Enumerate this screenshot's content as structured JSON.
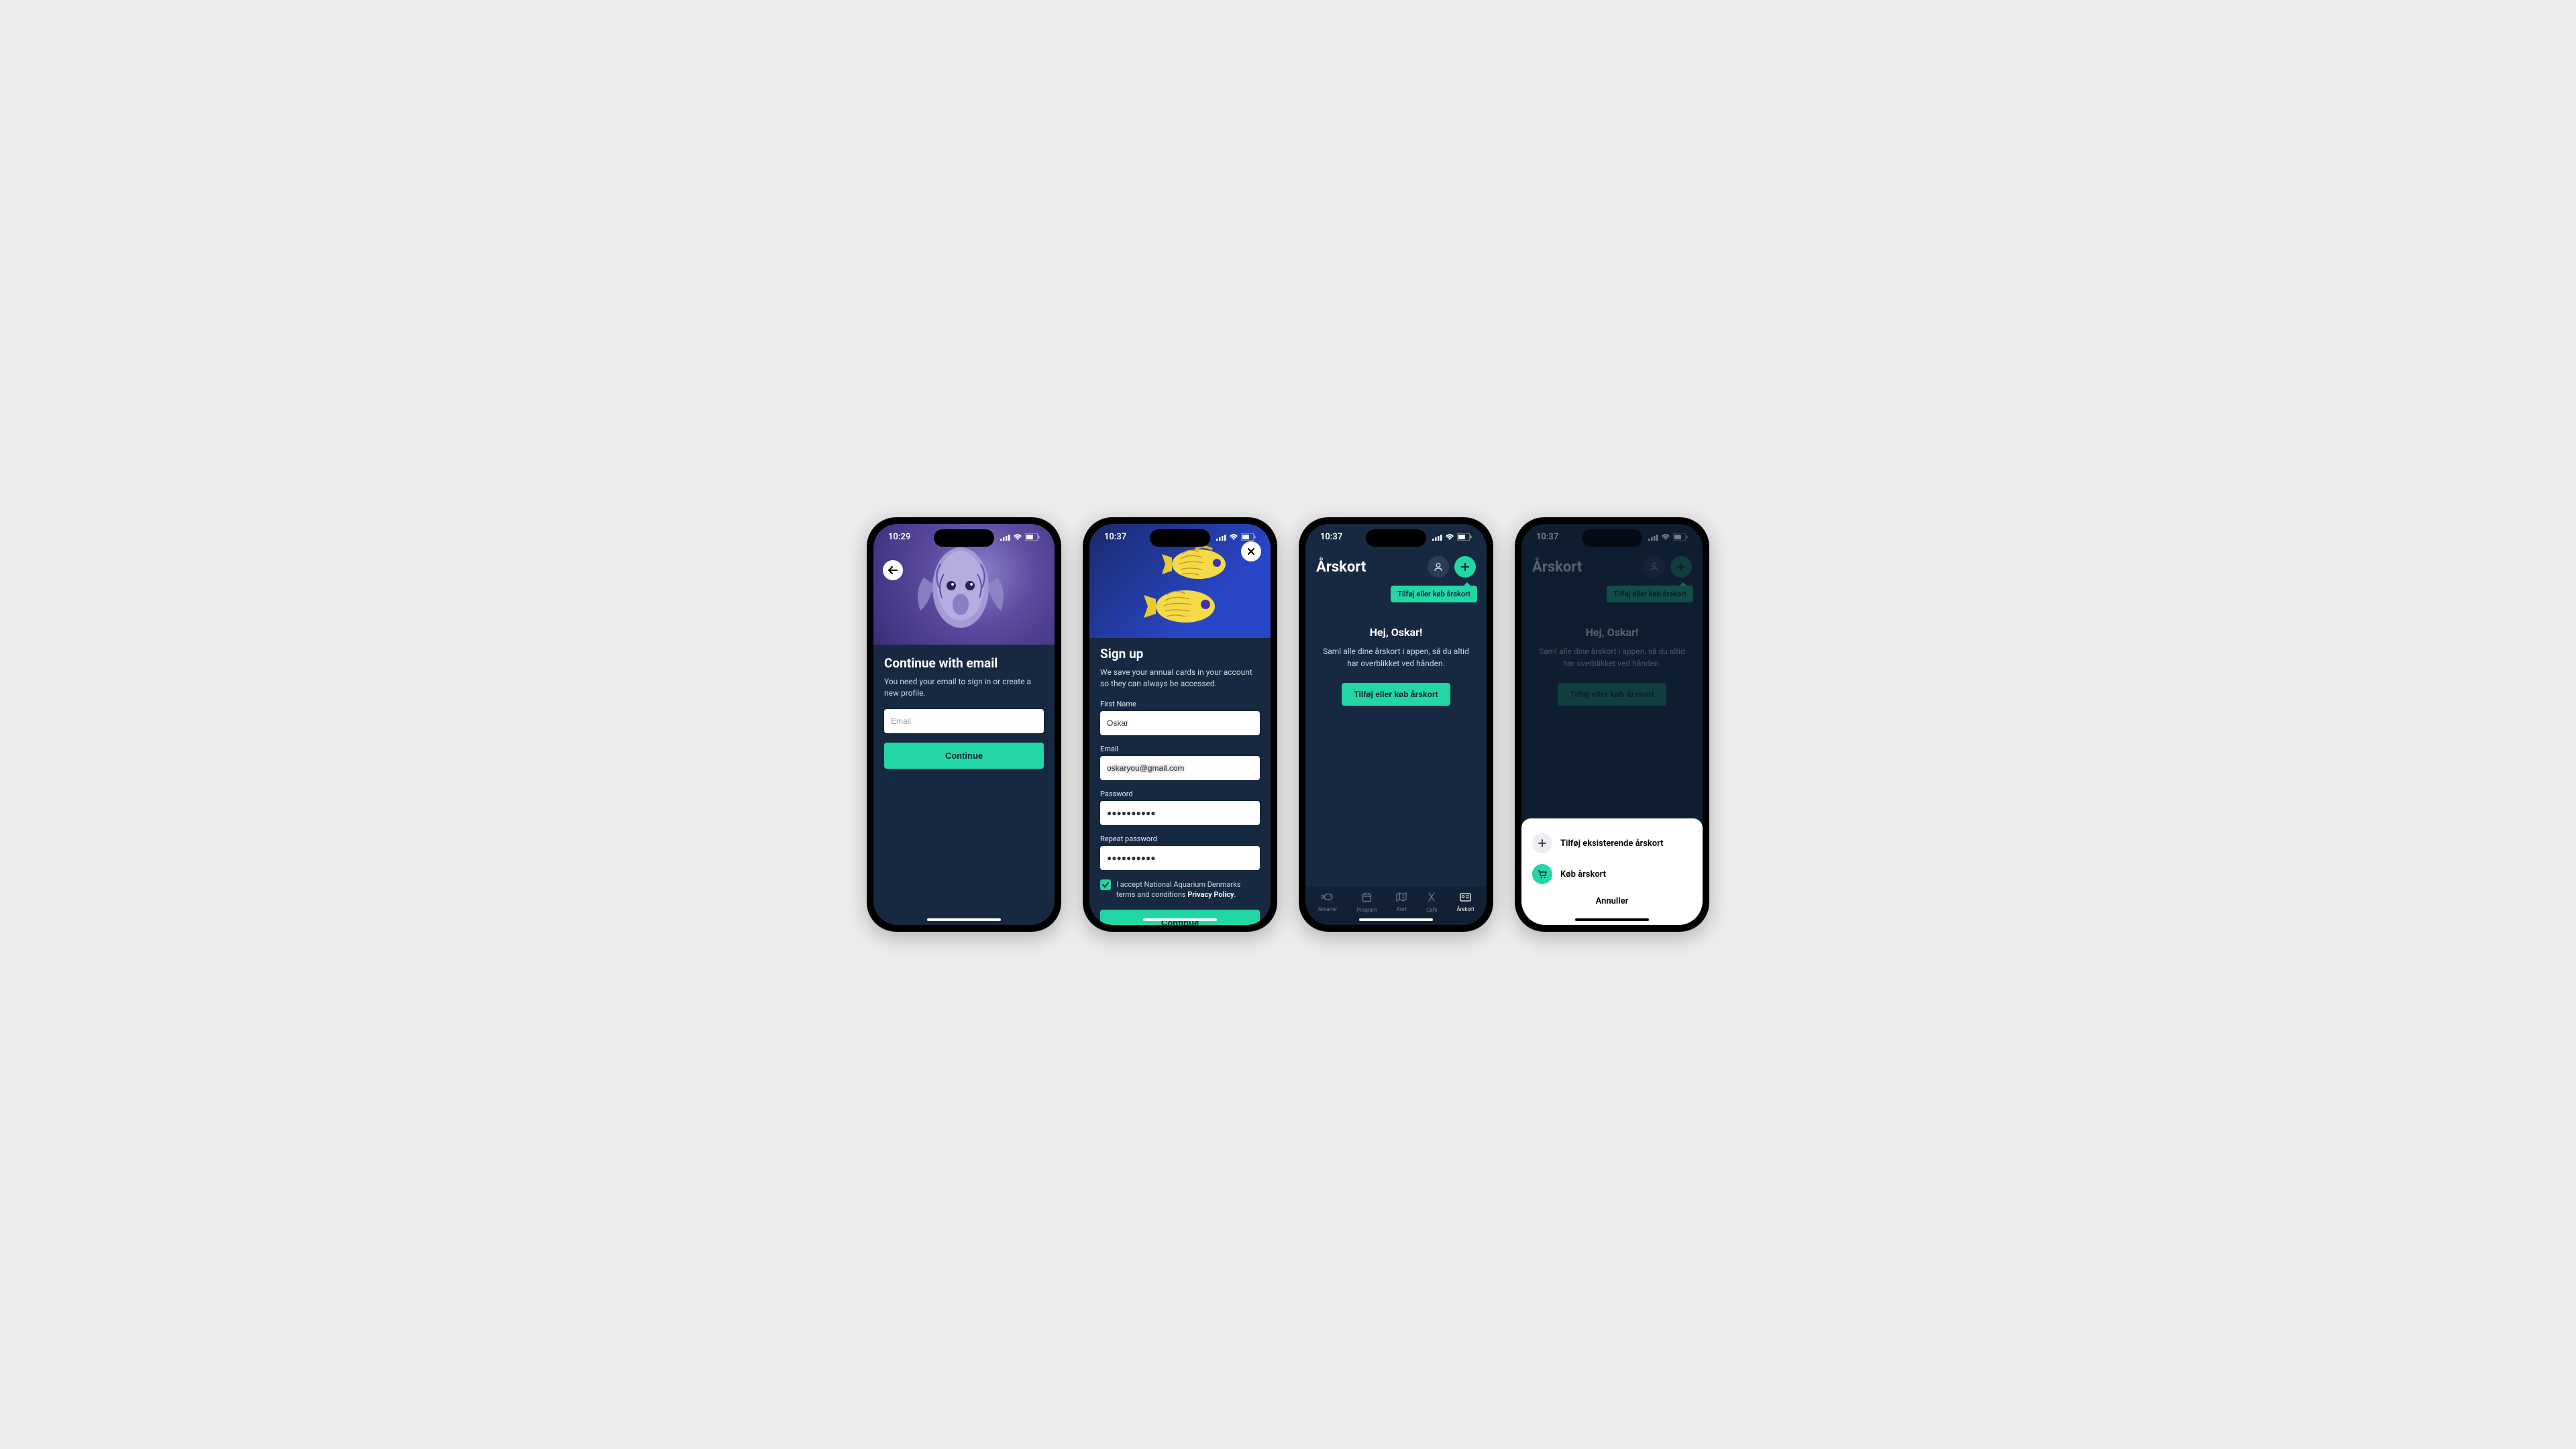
{
  "status": {
    "time1": "10:29",
    "time2": "10:37"
  },
  "screen1": {
    "title": "Continue with email",
    "subtitle": "You need your email to sign in or create a new profile.",
    "email_placeholder": "Email",
    "continue": "Continue"
  },
  "screen2": {
    "title": "Sign up",
    "subtitle": "We save your annual cards in your account so they can always be accessed.",
    "first_name_label": "First Name",
    "first_name_value": "Oskar",
    "email_label": "Email",
    "email_value": "oskaryou@gmail.com",
    "password_label": "Password",
    "password_value": "●●●●●●●●●●",
    "repeat_label": "Repeat password",
    "repeat_value": "●●●●●●●●●●",
    "terms_prefix": "I accept National Aquarium Denmarks terms and conditions ",
    "terms_link": "Privacy Policy",
    "continue": "Continue"
  },
  "screen3": {
    "title": "Årskort",
    "tooltip": "Tilføj eller køb årskort",
    "welcome_title": "Hej, Oskar!",
    "welcome_text": "Saml alle dine årskort i appen, så du altid har overblikket ved hånden.",
    "cta": "Tilføj eller køb årskort",
    "tabs": {
      "akvarier": "Akvarier",
      "program": "Program",
      "kort": "Kort",
      "cafe": "Café",
      "arskort": "Årskort"
    }
  },
  "screen4": {
    "sheet_add": "Tilføj eksisterende årskort",
    "sheet_buy": "Køb årskort",
    "sheet_cancel": "Annuller"
  }
}
